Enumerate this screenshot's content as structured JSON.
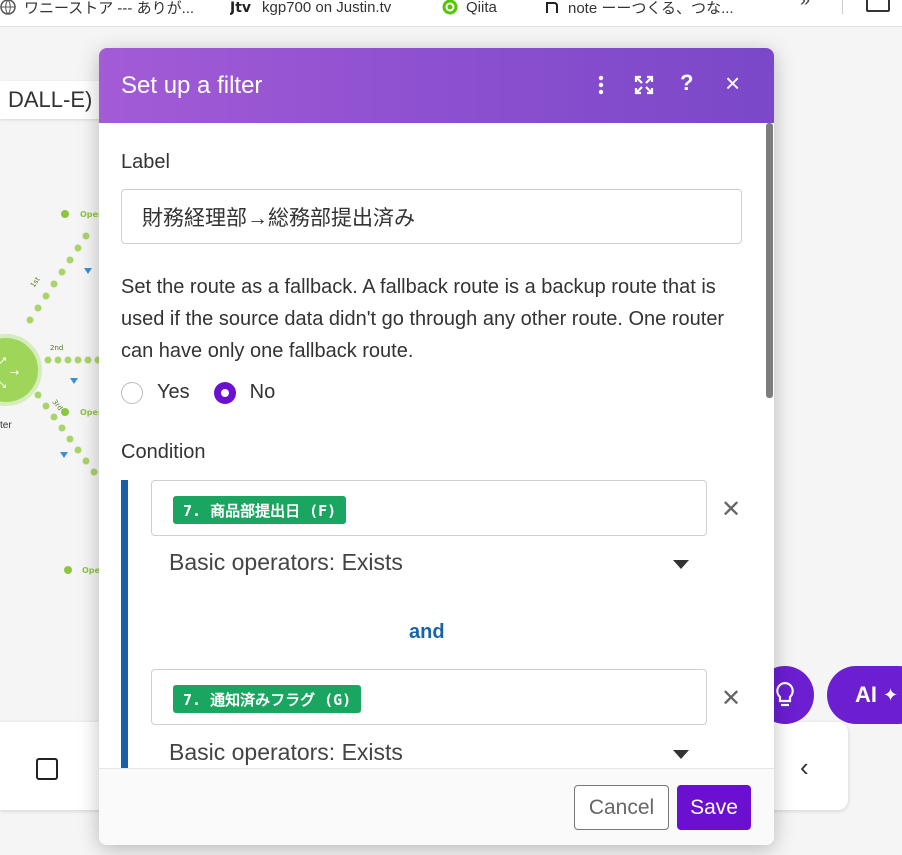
{
  "bookmarks": [
    {
      "label": "ワニーストア --- ありが...",
      "icon": "globe-icon"
    },
    {
      "label": "kgp700 on Justin.tv",
      "icon": "justin-tv-icon"
    },
    {
      "label": "Qiita",
      "icon": "qiita-icon"
    },
    {
      "label": "note ーーつくる、つな...",
      "icon": "note-icon"
    }
  ],
  "bookmarks_more": "»",
  "scenario_title": "DALL-E)",
  "canvas": {
    "path_labels": [
      "1st",
      "2nd",
      "3rd"
    ],
    "node_labels": [
      "Oper",
      "Oper",
      "Ope"
    ],
    "router_label": "ter"
  },
  "ai_button_label": "AI",
  "modal": {
    "title": "Set up a filter",
    "label_heading": "Label",
    "label_value": "財務経理部→総務部提出済み",
    "fallback_text": "Set the route as a fallback. A fallback route is a backup route that is used if the source data didn't go through any other route. One router can have only one fallback route.",
    "fallback_options": [
      {
        "label": "Yes",
        "checked": false
      },
      {
        "label": "No",
        "checked": true
      }
    ],
    "condition_heading": "Condition",
    "conditions": [
      {
        "pill": "7. 商品部提出日 (F)",
        "operator": "Basic operators: Exists"
      },
      {
        "pill": "7. 通知済みフラグ (G)",
        "operator": "Basic operators: Exists"
      }
    ],
    "and_label": "and",
    "cancel_label": "Cancel",
    "save_label": "Save"
  },
  "colors": {
    "header_gradient_start": "#a35bd6",
    "header_gradient_end": "#7a48c9",
    "primary": "#6b0fd1",
    "pill": "#1aa660",
    "condition_bar": "#1a5fa8",
    "and_text": "#1a64a6",
    "node_green": "#8cc63f"
  }
}
